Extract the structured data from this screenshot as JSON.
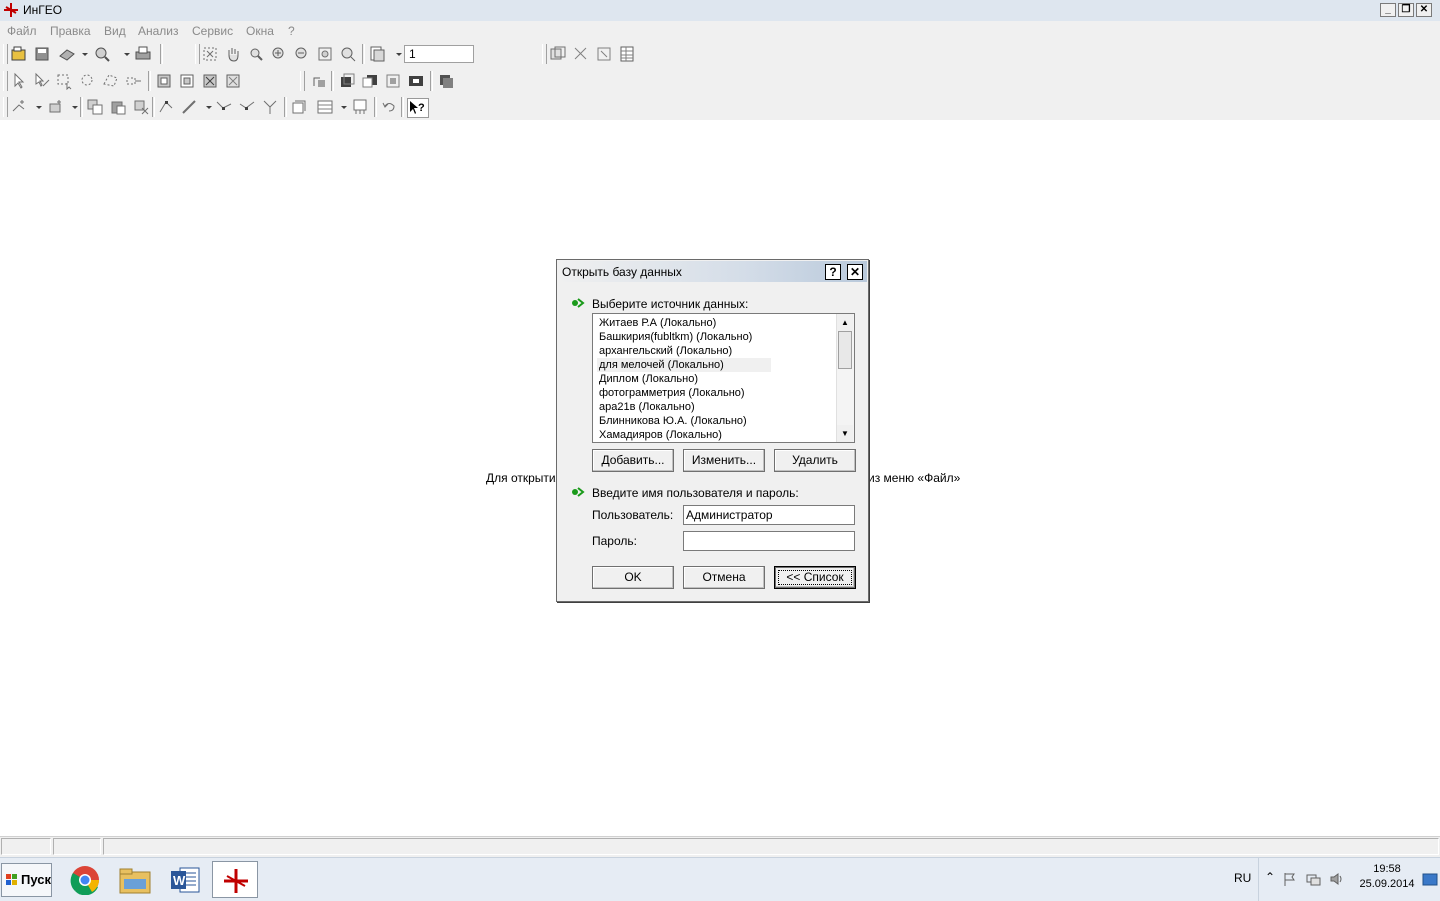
{
  "window": {
    "title": "ИнГЕО"
  },
  "menu": {
    "items": [
      "Файл",
      "Правка",
      "Вид",
      "Анализ",
      "Сервис",
      "Окна",
      "?"
    ]
  },
  "toolbar": {
    "page_number": "1"
  },
  "background": {
    "message_left": "Для открытия",
    "message_right": "из меню «Файл»"
  },
  "dialog": {
    "title": "Открыть базу данных",
    "help_label": "?",
    "close_label": "✕",
    "source_label": "Выберите источник данных:",
    "sources": [
      "Житаев Р.А (Локально)",
      "Башкирия(fubltkm) (Локально)",
      "архангельский (Локально)",
      "для мелочей (Локально)",
      "Диплом (Локально)",
      "фотограмметрия (Локально)",
      "ара21в (Локально)",
      "Блинникова Ю.А. (Локально)",
      "Хамадияров (Локально)"
    ],
    "selected_source_index": 3,
    "add_button": "Добавить...",
    "edit_button": "Изменить...",
    "delete_button": "Удалить",
    "credentials_label": "Введите имя пользователя и пароль:",
    "user_label": "Пользователь:",
    "user_value": "Администратор",
    "password_label": "Пароль:",
    "password_value": "",
    "ok_button": "OK",
    "cancel_button": "Отмена",
    "list_button": "<< Список"
  },
  "taskbar": {
    "start_label": "Пуск",
    "apps": [
      "chrome-icon",
      "explorer-icon",
      "word-icon",
      "ingeo-icon"
    ],
    "language": "RU",
    "time": "19:58",
    "date": "25.09.2014"
  },
  "colors": {
    "accent_red": "#c00000",
    "arrow_green": "#1a9a1a",
    "titlebar": "#dee6ef"
  }
}
